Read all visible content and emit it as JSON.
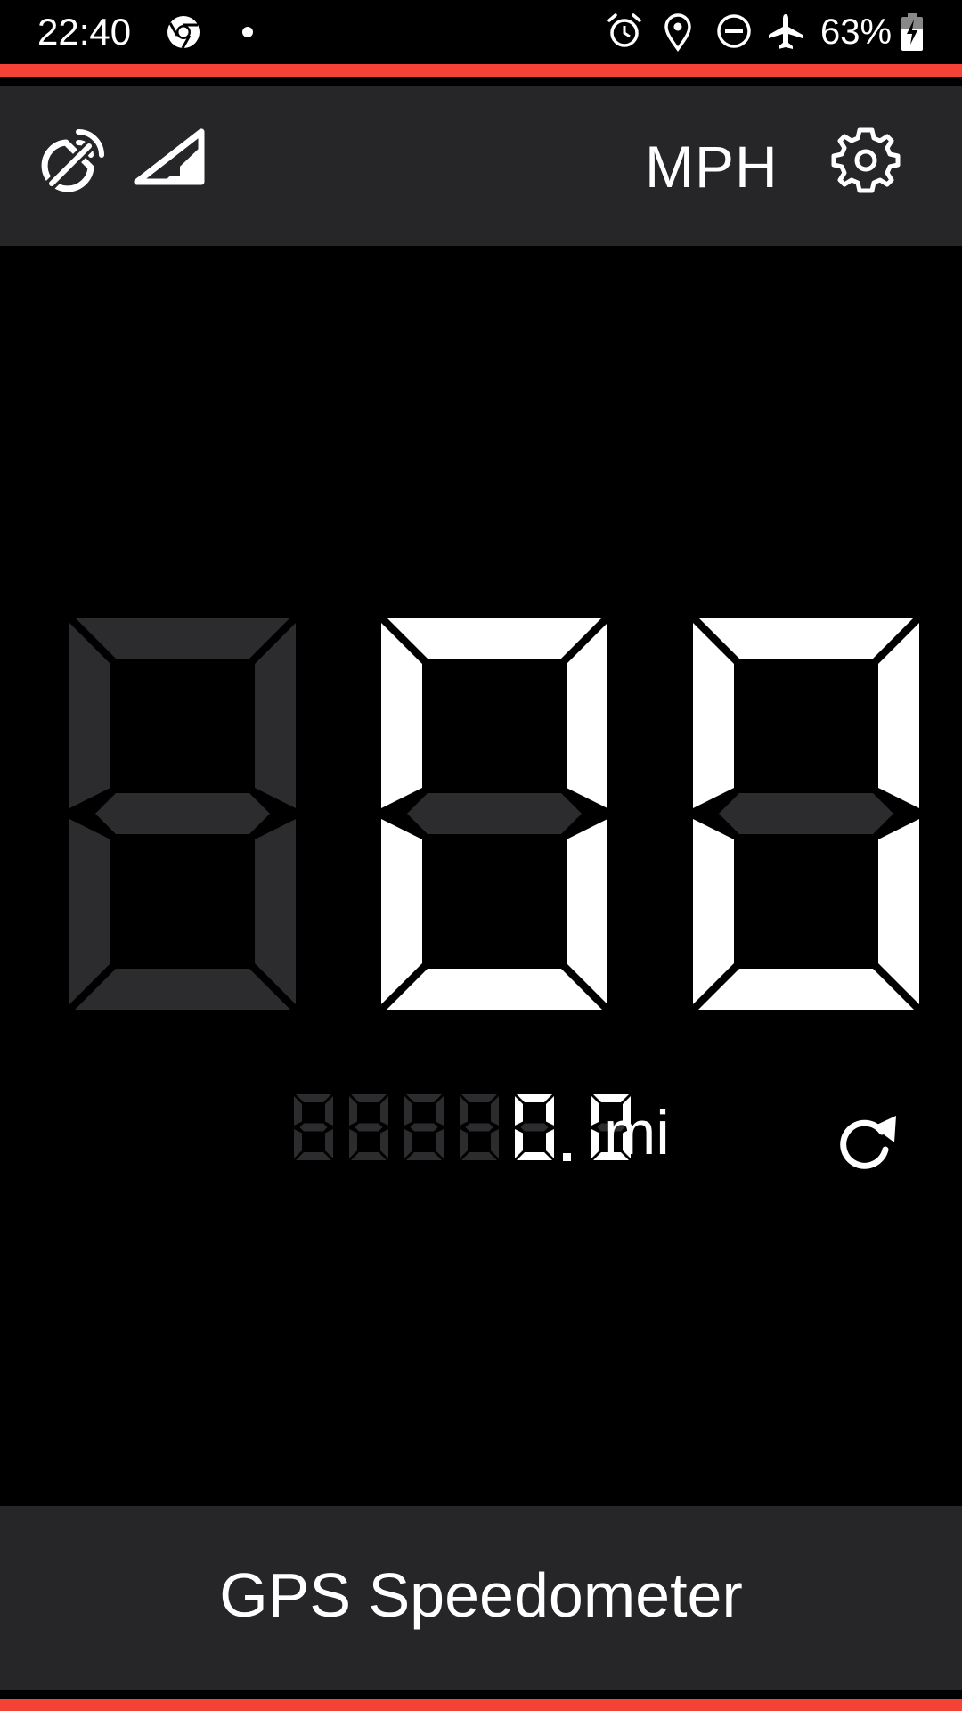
{
  "status_bar": {
    "time": "22:40",
    "battery_percent": "63%",
    "icons": [
      "chrome-icon",
      "notification-dot-icon",
      "alarm-icon",
      "location-icon",
      "do-not-disturb-icon",
      "airplane-mode-icon",
      "battery-charging-icon"
    ]
  },
  "toolbar": {
    "unit_label": "MPH",
    "icons": [
      "gps-off-icon",
      "signal-icon",
      "gear-icon"
    ]
  },
  "speed": {
    "value": 0,
    "digits_lit": [
      false,
      true,
      true
    ]
  },
  "odometer": {
    "value": "0.0",
    "unit": "mi"
  },
  "footer": {
    "title": "GPS Speedometer"
  },
  "colors": {
    "accent": "#f44336",
    "panel": "#262628",
    "background": "#000000",
    "segment_lit": "#ffffff",
    "segment_dim": "#2c2c2e"
  }
}
